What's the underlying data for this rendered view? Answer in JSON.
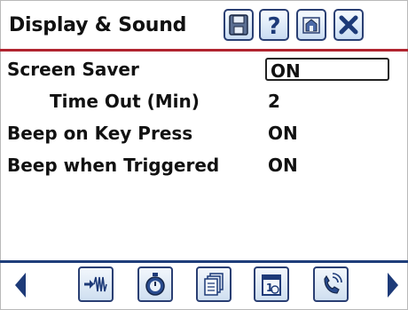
{
  "header": {
    "title": "Display & Sound",
    "buttons": [
      "save-icon",
      "help-icon",
      "home-icon",
      "close-icon"
    ]
  },
  "settings": [
    {
      "label": "Screen Saver",
      "value": "ON",
      "editing": true
    },
    {
      "label": "Time Out (Min)",
      "value": "2"
    },
    {
      "label": "Beep on Key Press",
      "value": "ON"
    },
    {
      "label": "Beep when Triggered",
      "value": "ON"
    }
  ],
  "nav": {
    "left_arrow": "left-arrow-icon",
    "right_arrow": "right-arrow-icon",
    "buttons": [
      "waveform-icon",
      "stopwatch-icon",
      "documents-icon",
      "calendar-icon",
      "phone-icon"
    ]
  },
  "colors": {
    "accent_red": "#b1242f",
    "nav_blue": "#1f3e7a",
    "button_border": "#2a3f73"
  }
}
